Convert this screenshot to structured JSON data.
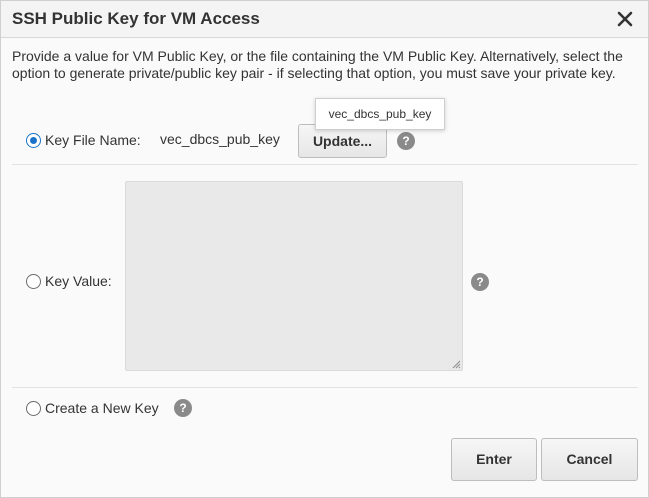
{
  "dialog": {
    "title": "SSH Public Key for VM Access",
    "description": "Provide a value for VM Public Key, or the file containing the VM Public Key. Alternatively, select the option to generate private/public key pair - if selecting that option, you must save your private key."
  },
  "options": {
    "key_file": {
      "label": "Key File Name:",
      "file_name": "vec_dbcs_pub_key",
      "update_button": "Update...",
      "tooltip": "vec_dbcs_pub_key",
      "selected": true
    },
    "key_value": {
      "label": "Key Value:",
      "value": "",
      "selected": false
    },
    "new_key": {
      "label": "Create a New Key",
      "selected": false
    }
  },
  "footer": {
    "enter_label": "Enter",
    "cancel_label": "Cancel"
  },
  "help_glyph": "?",
  "icons": {
    "close": "close-icon",
    "help": "help-icon"
  },
  "colors": {
    "accent": "#1a73c8",
    "help_icon": "#8a8a8a",
    "textarea_bg": "#e9e9e9"
  }
}
